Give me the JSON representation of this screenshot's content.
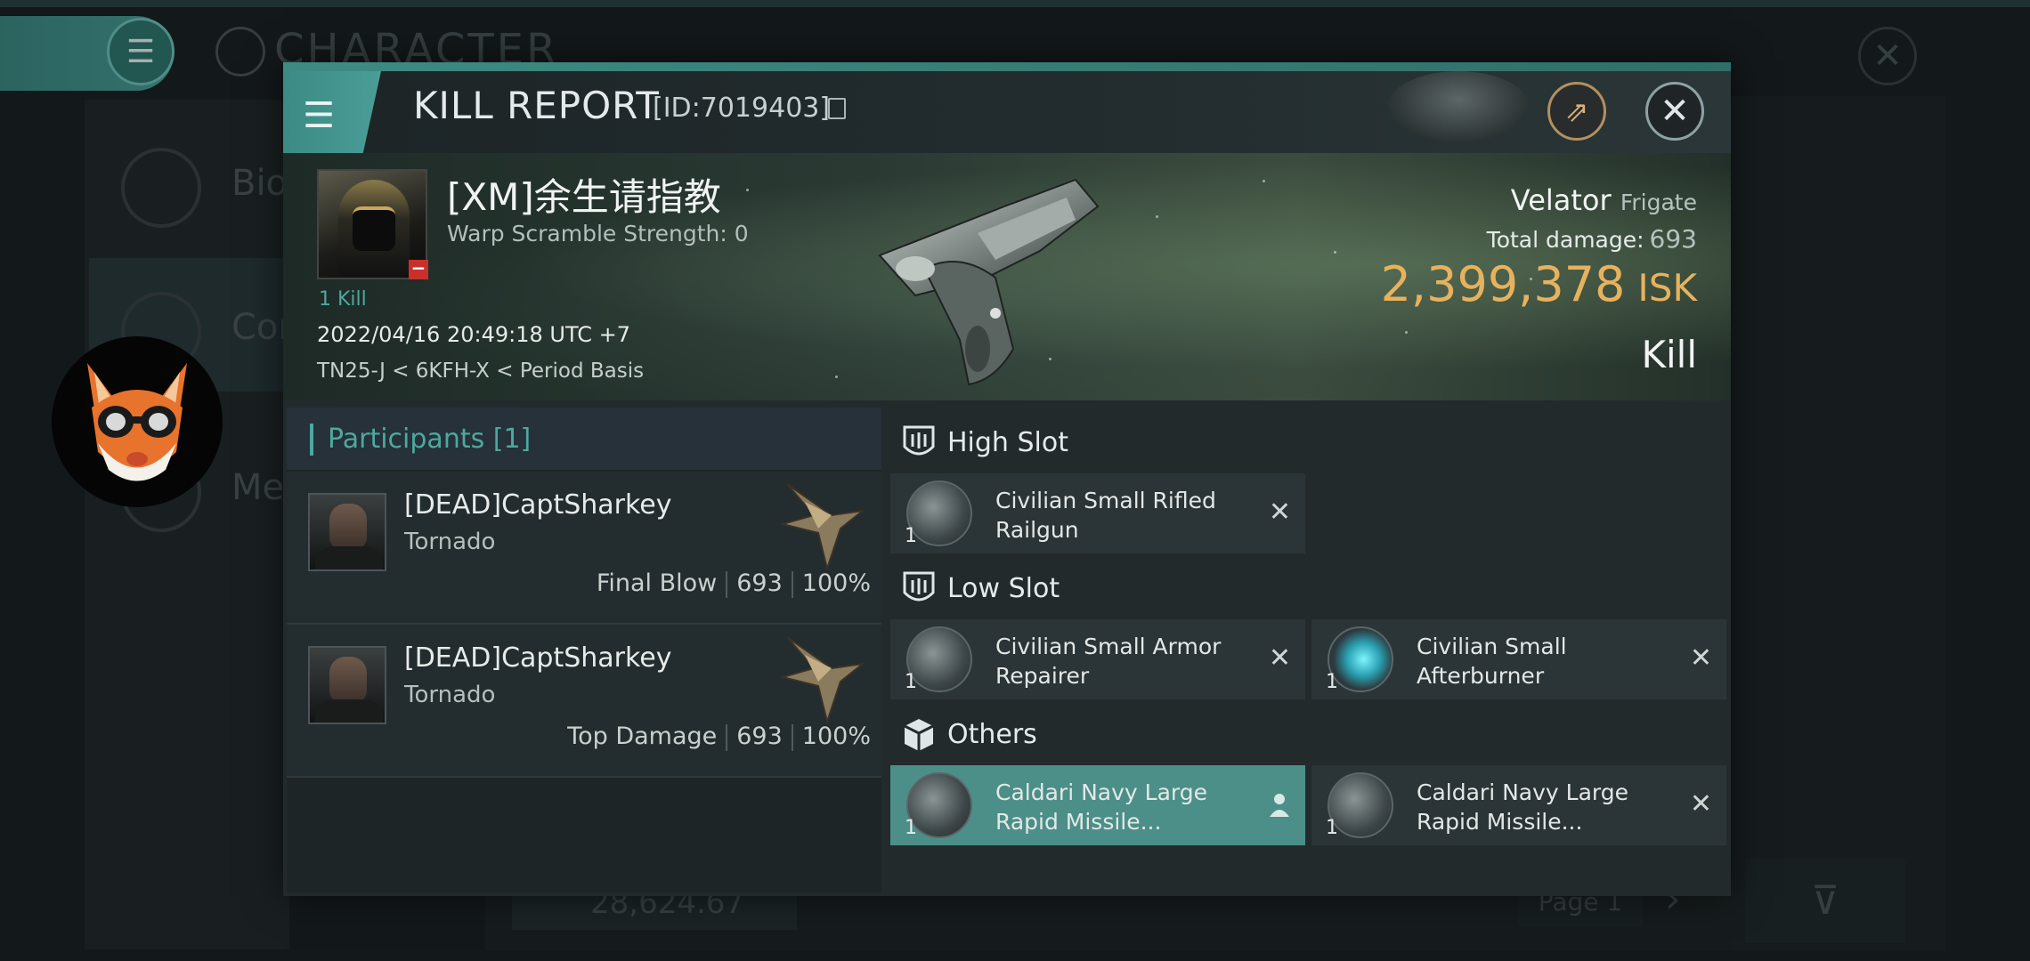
{
  "background": {
    "title": "CHARACTER",
    "left_items": [
      {
        "label": "Bio"
      },
      {
        "label": "Cor"
      },
      {
        "label": "Me"
      }
    ],
    "bottom_value": "28,624.67",
    "page_label": "Page 1"
  },
  "modal": {
    "title": "KILL REPORT",
    "report_id": "[ID:7019403]"
  },
  "victim": {
    "name": "[XM]余生请指教",
    "warp_scramble": "Warp Scramble Strength: 0",
    "kills": "1 Kill",
    "datetime": "2022/04/16 20:49:18 UTC +7",
    "location": "TN25-J < 6KFH-X < Period Basis",
    "ship_name": "Velator",
    "ship_class": "Frigate",
    "total_damage_label": "Total damage:",
    "total_damage": "693",
    "isk_value": "2,399,378",
    "isk_unit": "ISK",
    "result": "Kill"
  },
  "participants": {
    "header": "Participants [1]",
    "rows": [
      {
        "name": "[DEAD]CaptSharkey",
        "ship": "Tornado",
        "tag": "Final Blow",
        "damage": "693",
        "percent": "100%"
      },
      {
        "name": "[DEAD]CaptSharkey",
        "ship": "Tornado",
        "tag": "Top Damage",
        "damage": "693",
        "percent": "100%"
      }
    ]
  },
  "fitting": {
    "high_slot": {
      "label": "High Slot",
      "items": [
        {
          "name": "Civilian Small Rifled Railgun",
          "qty": "1",
          "status": "destroyed"
        }
      ]
    },
    "low_slot": {
      "label": "Low Slot",
      "items": [
        {
          "name": "Civilian Small Armor Repairer",
          "qty": "1",
          "status": "destroyed"
        },
        {
          "name": "Civilian Small Afterburner",
          "qty": "1",
          "status": "destroyed"
        }
      ]
    },
    "others": {
      "label": "Others",
      "items": [
        {
          "name": "Caldari Navy Large Rapid Missile...",
          "qty": "1",
          "status": "dropped"
        },
        {
          "name": "Caldari Navy Large Rapid Missile...",
          "qty": "1",
          "status": "destroyed"
        }
      ]
    }
  },
  "colors": {
    "accent": "#4ea89e",
    "isk": "#e6b25d",
    "selected_item": "#4b8f88"
  }
}
